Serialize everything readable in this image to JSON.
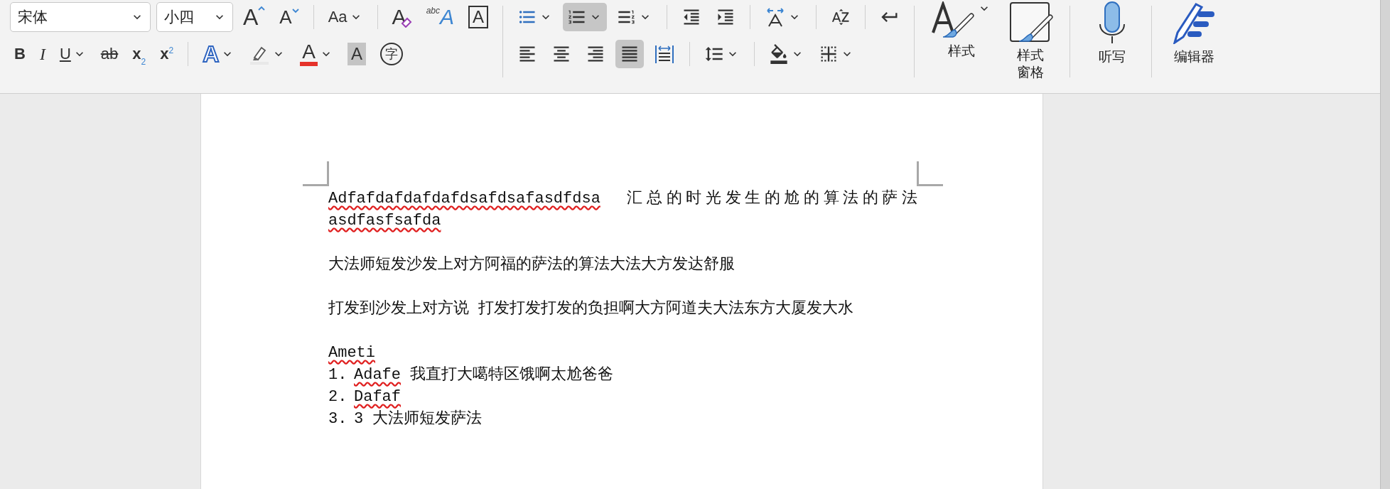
{
  "font_group": {
    "font_name": "宋体",
    "font_size": "小四",
    "row1": [
      {
        "kind": "grow",
        "label": "A",
        "dropdown": false
      },
      {
        "kind": "shrink",
        "label": "A",
        "dropdown": false
      },
      {
        "kind": "case",
        "label": "Aa",
        "dropdown": true
      },
      {
        "kind": "clear",
        "label": "A",
        "dropdown": false
      },
      {
        "kind": "phonetic",
        "label": "A",
        "small": "abc",
        "dropdown": false
      },
      {
        "kind": "border",
        "label": "A",
        "dropdown": false
      }
    ],
    "row2": [
      {
        "kind": "bold",
        "label": "B",
        "dropdown": false
      },
      {
        "kind": "italic",
        "label": "I",
        "dropdown": false
      },
      {
        "kind": "underline",
        "label": "U",
        "dropdown": true
      },
      {
        "kind": "strike",
        "label": "ab",
        "dropdown": false
      },
      {
        "kind": "sub",
        "label": "x",
        "small": "2",
        "dropdown": false
      },
      {
        "kind": "sup",
        "label": "x",
        "small": "2",
        "dropdown": false
      },
      {
        "kind": "effects",
        "label": "A",
        "dropdown": true
      },
      {
        "kind": "highlight",
        "dropdown": true
      },
      {
        "kind": "color",
        "label": "A",
        "dropdown": true
      },
      {
        "kind": "shading",
        "label": "A",
        "dropdown": false
      },
      {
        "kind": "enclose",
        "label": "字",
        "dropdown": false
      }
    ]
  },
  "paragraph_group": {
    "row1": [
      {
        "kind": "bullets",
        "selected": false,
        "dropdown": true
      },
      {
        "kind": "numbering",
        "selected": true,
        "dropdown": true
      },
      {
        "kind": "multilevel",
        "selected": false,
        "dropdown": true
      },
      {
        "kind": "outdent",
        "selected": false,
        "dropdown": false
      },
      {
        "kind": "indent",
        "selected": false,
        "dropdown": false
      },
      {
        "kind": "asian",
        "selected": false,
        "dropdown": true
      },
      {
        "kind": "sort",
        "selected": false,
        "dropdown": false
      },
      {
        "kind": "marks",
        "selected": false,
        "dropdown": false
      }
    ],
    "row2": [
      {
        "kind": "left",
        "selected": false,
        "dropdown": false
      },
      {
        "kind": "center",
        "selected": false,
        "dropdown": false
      },
      {
        "kind": "right",
        "selected": false,
        "dropdown": false
      },
      {
        "kind": "justify",
        "selected": true,
        "dropdown": false
      },
      {
        "kind": "distributed",
        "selected": false,
        "dropdown": false
      },
      {
        "kind": "spacing",
        "selected": false,
        "dropdown": true
      },
      {
        "kind": "fill",
        "selected": false,
        "dropdown": true
      },
      {
        "kind": "borders",
        "selected": false,
        "dropdown": true
      }
    ]
  },
  "big_groups": [
    [
      {
        "kind": "styles",
        "label": "样式",
        "dropdown": true
      },
      {
        "kind": "pane",
        "label": "样式窗格",
        "dropdown": false
      }
    ],
    [
      {
        "kind": "dictate",
        "label": "听写",
        "dropdown": false
      }
    ],
    [
      {
        "kind": "editor",
        "label": "编辑器",
        "dropdown": false
      }
    ]
  ],
  "document": {
    "blocks": [
      {
        "kind": "paragraph",
        "runs": [
          {
            "text": "Adfafdafdafdafdsafdsafasdfdsa",
            "misspelled": true
          },
          {
            "text": "  汇总的时光发生的尬的算法的萨法 ",
            "misspelled": false
          },
          {
            "text": "asdfasfsafda",
            "misspelled": true
          }
        ]
      },
      {
        "kind": "paragraph",
        "runs": [
          {
            "text": "大法师短发沙发上对方阿福的萨法的算法大法大方发达舒服",
            "misspelled": false
          }
        ]
      },
      {
        "kind": "paragraph",
        "runs": [
          {
            "text": "打发到沙发上对方说 打发打发打发的负担啊大方阿道夫大法东方大厦发大水",
            "misspelled": false
          }
        ]
      },
      {
        "kind": "list",
        "runs": [
          {
            "text": "Ameti",
            "misspelled": true
          }
        ],
        "items": [
          {
            "number": "1.",
            "runs": [
              {
                "text": "Adafe",
                "misspelled": true
              },
              {
                "text": " 我直打大噶特区饿啊太尬爸爸",
                "misspelled": false
              }
            ]
          },
          {
            "number": "2.",
            "runs": [
              {
                "text": "Dafaf",
                "misspelled": true
              }
            ]
          },
          {
            "number": "3.",
            "runs": [
              {
                "text": "3 大法师短发萨法",
                "misspelled": false
              }
            ]
          }
        ]
      }
    ]
  }
}
